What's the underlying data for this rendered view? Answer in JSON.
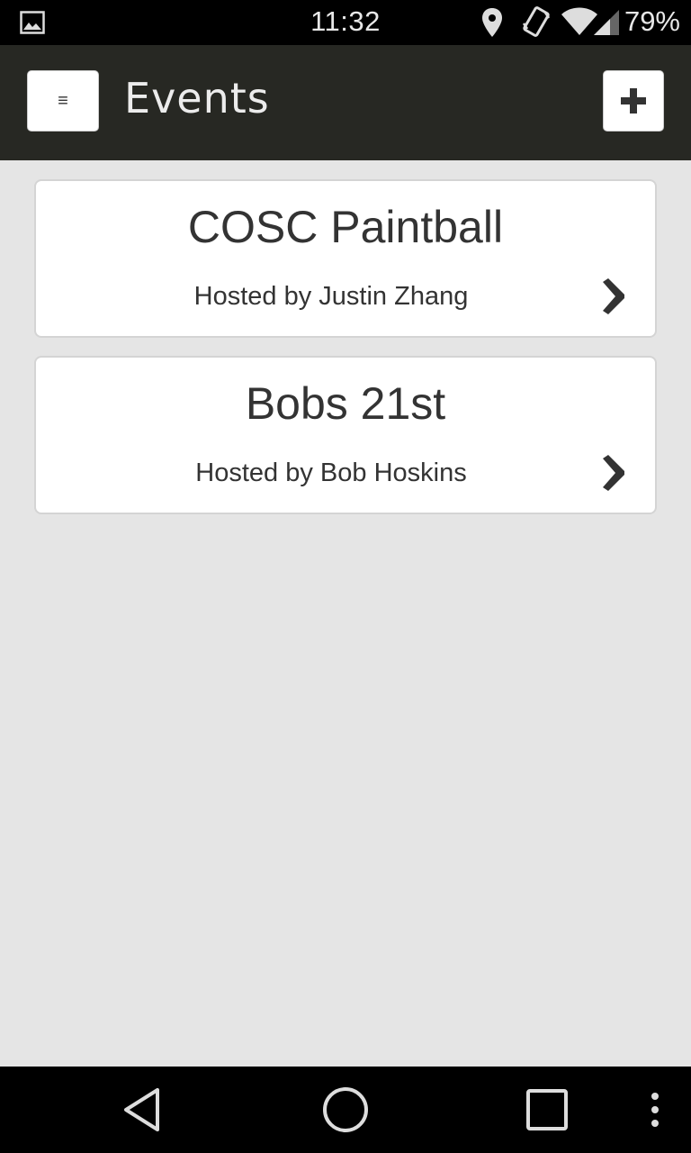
{
  "status_bar": {
    "time": "11:32",
    "battery": "79%",
    "icons": [
      "gallery-icon",
      "location-icon",
      "vibrate-icon",
      "wifi-icon",
      "signal-icon"
    ]
  },
  "header": {
    "title": "Events",
    "menu_icon": "≡",
    "add_icon": "plus-icon",
    "background": "#272823"
  },
  "events": [
    {
      "title": "COSC Paintball",
      "host": "Hosted by Justin Zhang"
    },
    {
      "title": "Bobs 21st",
      "host": "Hosted by Bob Hoskins"
    }
  ],
  "nav_bar": {
    "buttons": [
      "back-icon",
      "home-icon",
      "recents-icon",
      "overflow-icon"
    ]
  }
}
